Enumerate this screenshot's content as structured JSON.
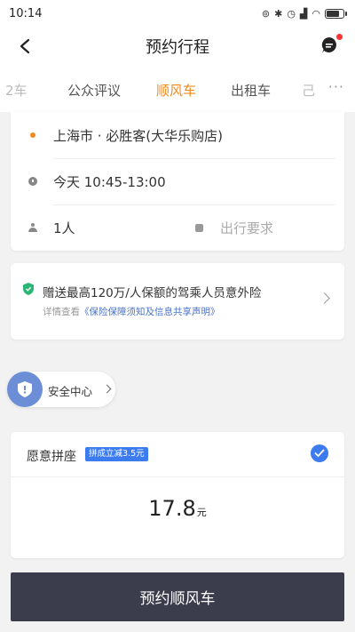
{
  "status_bar": {
    "time": "10:14",
    "icons": [
      "alarm-icon",
      "bluetooth-icon",
      "clock-icon",
      "signal-icon",
      "wifi-icon",
      "battery-icon"
    ],
    "battery_level": 0.7
  },
  "nav": {
    "title": "预约行程",
    "back_icon": "back-arrow-icon",
    "message_icon": "message-icon"
  },
  "tabs": [
    {
      "label": "2车",
      "state": "fade"
    },
    {
      "label": "公众评议",
      "state": "normal"
    },
    {
      "label": "顺风车",
      "state": "active"
    },
    {
      "label": "出租车",
      "state": "normal"
    },
    {
      "label": "己",
      "state": "fade"
    }
  ],
  "route": {
    "origin": "上海市 · 必胜客(大华乐购店)",
    "time": "今天 10:45-13:00",
    "passengers": "1人",
    "requirements_placeholder": "出行要求"
  },
  "insurance": {
    "title": "赠送最高120万/人保额的驾乘人员意外险",
    "sub_prefix": "详情查看",
    "sub_link": "《保险保障须知及信息共享声明》"
  },
  "safety": {
    "label": "安全中心"
  },
  "carpool": {
    "title": "愿意拼座",
    "badge": "拼成立减3.5元",
    "price": "17.8",
    "unit": "元",
    "checked": true
  },
  "primary_button": {
    "label": "预约顺风车"
  },
  "colors": {
    "accent": "#f08a1c",
    "blue": "#3d7bf0",
    "button_bg": "#3b3d4c"
  }
}
